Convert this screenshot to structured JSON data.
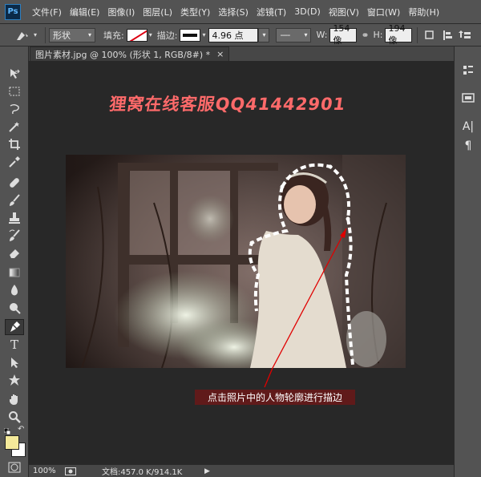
{
  "app_logo": "Ps",
  "menu": [
    "文件(F)",
    "编辑(E)",
    "图像(I)",
    "图层(L)",
    "类型(Y)",
    "选择(S)",
    "滤镜(T)",
    "3D(D)",
    "视图(V)",
    "窗口(W)",
    "帮助(H)"
  ],
  "options": {
    "mode": "形状",
    "fill_label": "填充:",
    "stroke_label": "描边:",
    "stroke_width": "4.96 点",
    "w_label": "W:",
    "w_value": "154 像",
    "h_label": "H:",
    "h_value": "194 像"
  },
  "document": {
    "tab_title": "图片素材.jpg @ 100% (形状 1, RGB/8#) *",
    "close": "×"
  },
  "watermark": "狸窝在线客服QQ41442901",
  "caption": "点击照片中的人物轮廓进行描边",
  "status": {
    "zoom": "100%",
    "doc_info": "文档:457.0 K/914.1K"
  },
  "colors": {
    "ui_bg": "#535353",
    "canvas_bg": "#282828",
    "watermark": "#ff6a6a",
    "arrow": "#e00000",
    "foreground_swatch": "#f4e99a",
    "background_swatch": "#ffffff"
  },
  "tools": [
    "move-icon",
    "marquee-icon",
    "lasso-icon",
    "magic-wand-icon",
    "crop-icon",
    "eyedropper-icon",
    "healing-brush-icon",
    "brush-icon",
    "clone-stamp-icon",
    "history-brush-icon",
    "eraser-icon",
    "gradient-icon",
    "blur-icon",
    "dodge-icon",
    "pen-icon",
    "type-icon",
    "path-selection-icon",
    "custom-shape-icon",
    "hand-icon",
    "zoom-icon"
  ],
  "right_panel_icons": [
    "history-icon",
    "properties-icon",
    "character-icon",
    "paragraph-icon"
  ]
}
